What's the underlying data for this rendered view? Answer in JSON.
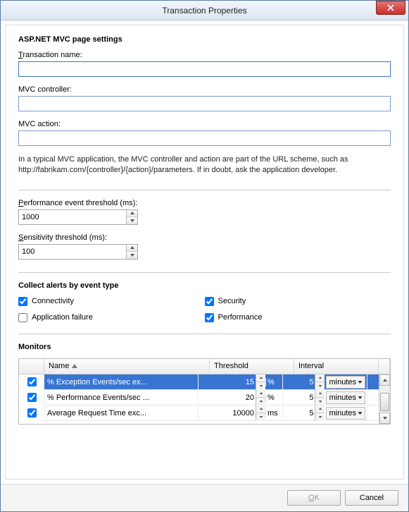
{
  "window": {
    "title": "Transaction Properties"
  },
  "section1": {
    "heading": "ASP.NET MVC page settings",
    "transaction_name_label": "Transaction name:",
    "transaction_name_value": "",
    "mvc_controller_label": "MVC controller:",
    "mvc_controller_value": "",
    "mvc_action_label": "MVC action:",
    "mvc_action_value": "",
    "help_text": "In a typical MVC application, the MVC controller and action are part of the URL scheme, such as http://fabrikam.com/{controller}/{action}/parameters. If in doubt, ask the application developer.",
    "perf_threshold_label": "Performance event threshold (ms):",
    "perf_threshold_value": "1000",
    "sens_threshold_label": "Sensitivity threshold (ms):",
    "sens_threshold_value": "100"
  },
  "alerts": {
    "heading": "Collect alerts by event type",
    "connectivity": {
      "label": "Connectivity",
      "checked": true
    },
    "security": {
      "label": "Security",
      "checked": true
    },
    "app_failure": {
      "label": "Application failure",
      "checked": false
    },
    "performance": {
      "label": "Performance",
      "checked": true
    }
  },
  "monitors": {
    "heading": "Monitors",
    "columns": {
      "name": "Name",
      "threshold": "Threshold",
      "interval": "Interval"
    },
    "rows": [
      {
        "checked": true,
        "name": "% Exception Events/sec ex...",
        "threshold": "15",
        "threshold_unit": "%",
        "interval": "5",
        "interval_unit": "minutes",
        "selected": true
      },
      {
        "checked": true,
        "name": "% Performance Events/sec ...",
        "threshold": "20",
        "threshold_unit": "%",
        "interval": "5",
        "interval_unit": "minutes",
        "selected": false
      },
      {
        "checked": true,
        "name": "Average Request Time exc...",
        "threshold": "10000",
        "threshold_unit": "ms",
        "interval": "5",
        "interval_unit": "minutes",
        "selected": false
      }
    ]
  },
  "footer": {
    "ok": "OK",
    "cancel": "Cancel"
  }
}
